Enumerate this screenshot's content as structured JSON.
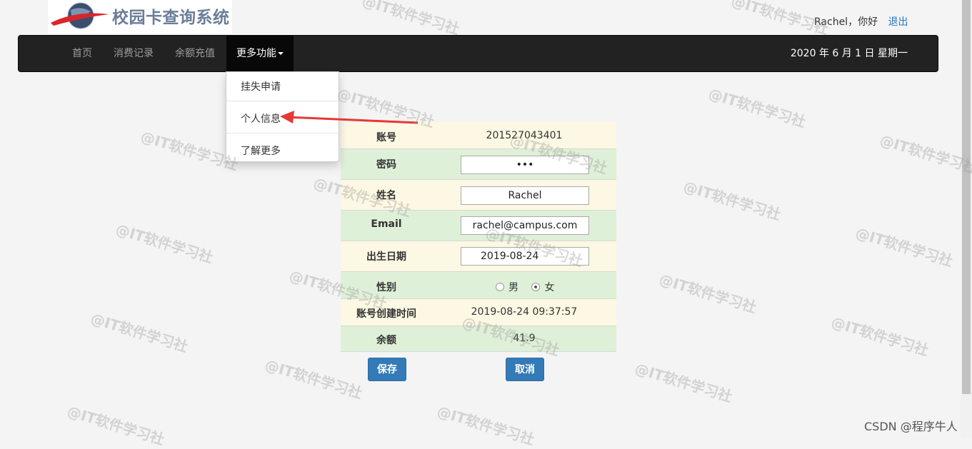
{
  "header": {
    "logo_text": "校园卡查询系统",
    "greeting": "Rachel，你好",
    "logout": "退出"
  },
  "nav": {
    "items": [
      "首页",
      "消费记录",
      "余额充值"
    ],
    "more": "更多功能",
    "date": "2020 年 6 月 1 日 星期一"
  },
  "dropdown": {
    "items": [
      "挂失申请",
      "个人信息",
      "了解更多"
    ]
  },
  "form": {
    "account_label": "账号",
    "account_value": "201527043401",
    "password_label": "密码",
    "password_value": "•••",
    "name_label": "姓名",
    "name_value": "Rachel",
    "email_label": "Email",
    "email_value": "rachel@campus.com",
    "birth_label": "出生日期",
    "birth_value": "2019-08-24",
    "gender_label": "性别",
    "gender_male": "男",
    "gender_female": "女",
    "gender_selected": "女",
    "created_label": "账号创建时间",
    "created_value": "2019-08-24 09:37:57",
    "balance_label": "余额",
    "balance_value": "41.9"
  },
  "buttons": {
    "save": "保存",
    "cancel": "取消"
  },
  "watermark_text": "@IT软件学习社",
  "footer_credit": "CSDN @程序牛人",
  "colors": {
    "navbar": "#222222",
    "cream_row": "#fcf8e3",
    "green_row": "#dff0d8",
    "primary_button": "#337ab7",
    "arrow": "#e53935"
  }
}
